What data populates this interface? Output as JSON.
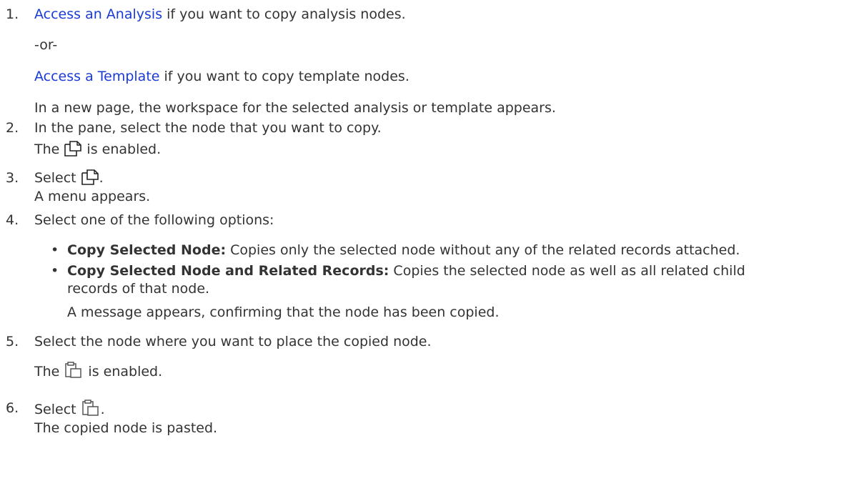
{
  "steps": [
    {
      "number": "1.",
      "link1": "Access an Analysis",
      "text1": " if you want to copy analysis nodes.",
      "or": "-or-",
      "link2": "Access a Template",
      "text2": " if you want to copy template nodes.",
      "result": "In a new page, the workspace for the selected analysis or template appears."
    },
    {
      "number": "2.",
      "text": "In the pane, select the node that you want to copy.",
      "result_prefix": "The ",
      "result_suffix": " is enabled."
    },
    {
      "number": "3.",
      "text_prefix": "Select ",
      "text_suffix": ".",
      "result": "A menu appears."
    },
    {
      "number": "4.",
      "text": "Select one of the following options:",
      "options": [
        {
          "bullet": "•",
          "label": "Copy Selected Node:",
          "description": " Copies only the selected node without any of the related records attached."
        },
        {
          "bullet": "•",
          "label": "Copy Selected Node and Related Records:",
          "description": " Copies the selected node as well as all related child",
          "description_cont": "records of that node."
        }
      ],
      "result": "A message appears, confirming that the node has been copied."
    },
    {
      "number": "5.",
      "text": "Select the node where you want to place the copied node.",
      "result_prefix": "The ",
      "result_suffix": " is enabled."
    },
    {
      "number": "6.",
      "text_prefix": "Select ",
      "text_suffix": ".",
      "result": "The copied node is pasted."
    }
  ],
  "icons": {
    "copy": "copy-icon",
    "paste": "paste-icon"
  },
  "colors": {
    "link": "#1a3bd6",
    "text": "#333333"
  }
}
